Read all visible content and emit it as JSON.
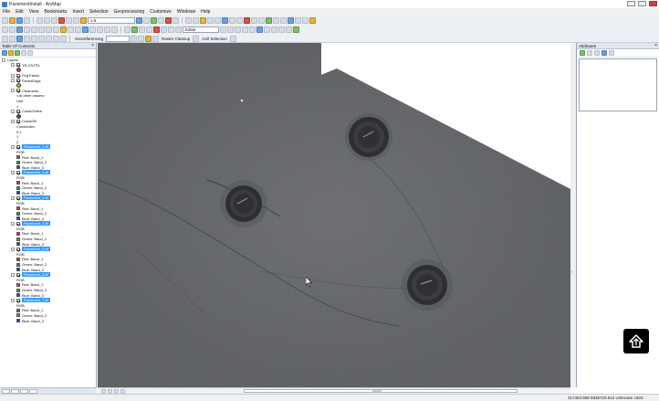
{
  "window": {
    "title": "PavementInstall - ArcMap"
  },
  "menu": [
    "File",
    "Edit",
    "View",
    "Bookmarks",
    "Insert",
    "Selection",
    "Geoprocessing",
    "Customize",
    "Windows",
    "Help"
  ],
  "toolbar": {
    "scale_value": "1:6",
    "georef_label": "Georeferencing",
    "raster_cleanup_label": "Raster Cleanup",
    "cell_selection_label": "Cell Selection",
    "editor_label": "Editor"
  },
  "toc": {
    "title": "Table Of Contents",
    "root": "Layers",
    "items": [
      {
        "label": "TR-CNTRL",
        "kind": "layer",
        "symbol": "dot",
        "color": "#c9462f"
      },
      {
        "label": "PegTracks",
        "kind": "layer",
        "symbol": "none"
      },
      {
        "label": "PavedEdge",
        "kind": "layer",
        "symbol": "dot",
        "color": "#e0b236"
      },
      {
        "label": "Clearness",
        "kind": "layer",
        "symbol": "legend",
        "legend": [
          "<all other values>",
          "Unit",
          "1"
        ]
      },
      {
        "label": "CrackOnline",
        "kind": "layer",
        "symbol": "dot",
        "color": "#2056a8"
      },
      {
        "label": "CrackOK",
        "kind": "layer",
        "symbol": "legend",
        "legend": [
          "CrackIndex",
          "0.1",
          "1",
          "2"
        ]
      }
    ],
    "rasters": [
      {
        "label": "Pavement_1.tif",
        "bands": [
          "RGB",
          "Red:   Band_1",
          "Green: Band_2",
          "Blue:  Band_3"
        ]
      },
      {
        "label": "Pavement_2.tif",
        "bands": [
          "RGB",
          "Red:   Band_1",
          "Green: Band_2",
          "Blue:  Band_3"
        ]
      },
      {
        "label": "Pavement_3.tif",
        "bands": [
          "RGB",
          "Red:   Band_1",
          "Green: Band_2",
          "Blue:  Band_3"
        ]
      },
      {
        "label": "Pavement_4.tif",
        "bands": [
          "RGB",
          "Red:   Band_1",
          "Green: Band_2",
          "Blue:  Band_3"
        ]
      },
      {
        "label": "Pavement_5.tif",
        "bands": [
          "RGB",
          "Red:   Band_1",
          "Green: Band_2",
          "Blue:  Band_3"
        ]
      },
      {
        "label": "Pavement_6.tif",
        "bands": [
          "RGB",
          "Red:   Band_1",
          "Green: Band_2",
          "Blue:  Band_3"
        ]
      },
      {
        "label": "Pavement_7.tif",
        "bands": [
          "RGB",
          "Red:   Band_1",
          "Green: Band_2",
          "Blue:  Band_3"
        ]
      }
    ],
    "band_colors": [
      "#d23a2d",
      "#2ca342",
      "#2b3fb8"
    ]
  },
  "attributes": {
    "title": "Attributes"
  },
  "status": {
    "coords": "317484.908  5935723.612 Unknown Units"
  },
  "colors": {
    "accent": "#3399ff",
    "pavement": "#5d5f63"
  },
  "icons": [
    "arcmap-app-icon",
    "upload-home-icon",
    "pointer-cursor-icon"
  ]
}
